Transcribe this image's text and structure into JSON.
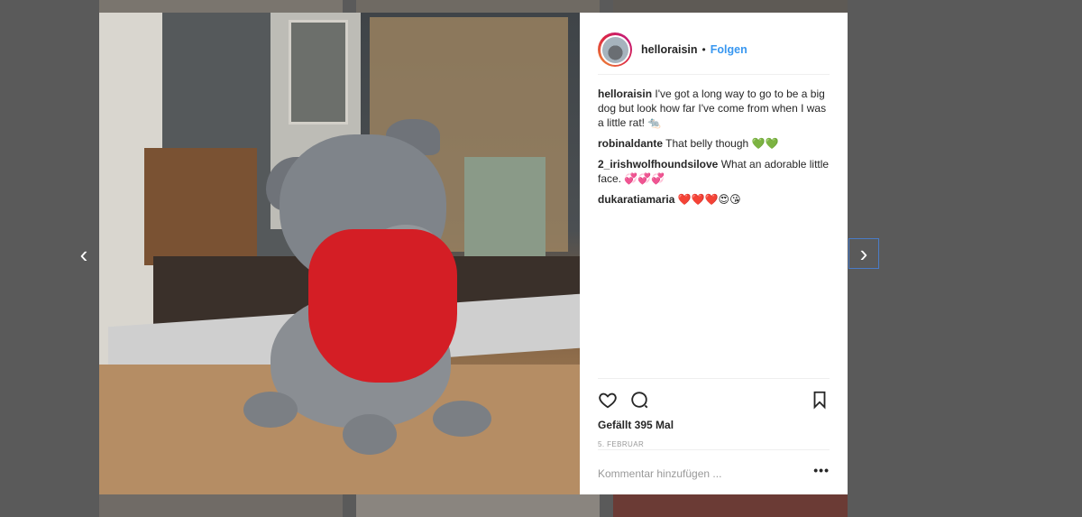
{
  "header": {
    "username": "helloraisin",
    "separator": "•",
    "follow_label": "Folgen"
  },
  "comments": [
    {
      "user": "helloraisin",
      "text": "I've got a long way to go to be a big dog but look how far I've come from when I was a little rat! 🐀"
    },
    {
      "user": "robinaldante",
      "text": "That belly though 💚💚"
    },
    {
      "user": "2_irishwolfhoundsilove",
      "text": "What an adorable little face. 💞💞💞"
    },
    {
      "user": "dukaratiamaria",
      "text": "❤️❤️❤️😍😘"
    }
  ],
  "post": {
    "likes": "Gefällt 395 Mal",
    "date": "5. FEBRUAR",
    "add_comment_placeholder": "Kommentar hinzufügen ...",
    "more_label": "•••"
  },
  "nav": {
    "prev": "‹",
    "next": "›"
  },
  "icons": [
    "heart-icon",
    "comment-icon",
    "bookmark-icon",
    "chevron-left-icon",
    "chevron-right-icon"
  ],
  "colors": {
    "accent": "#3897f0",
    "scarf": "#d41e25"
  }
}
